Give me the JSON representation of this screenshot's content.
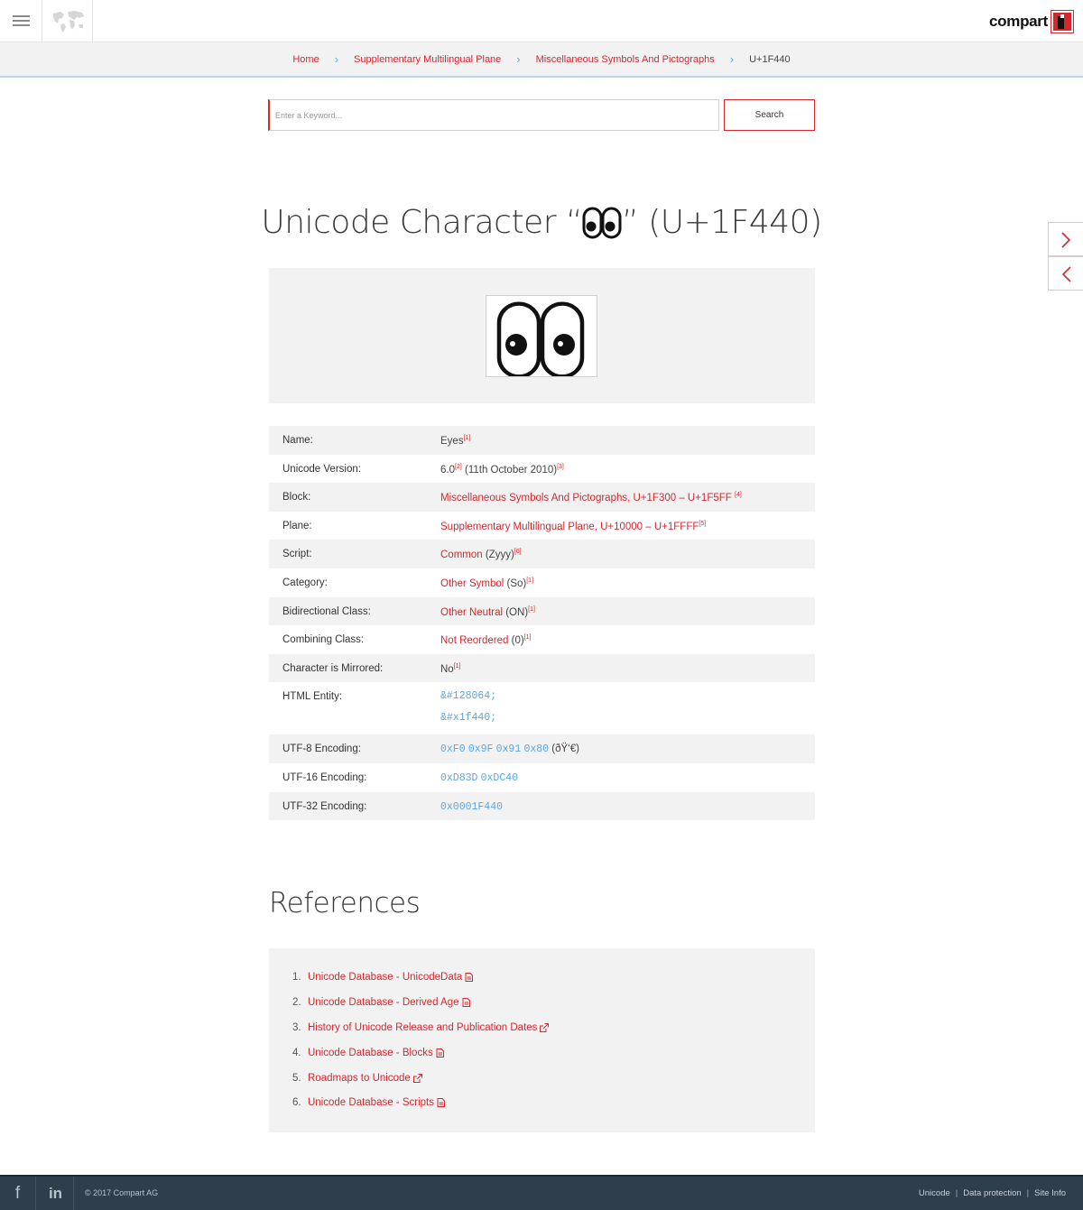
{
  "header": {
    "logo_text": "compart"
  },
  "breadcrumb": {
    "items": [
      "Home",
      "Supplementary Multilingual Plane",
      "Miscellaneous Symbols And Pictographs"
    ],
    "current": "U+1F440"
  },
  "search": {
    "placeholder": "Enter a Keyword...",
    "button_label": "Search"
  },
  "title": {
    "prefix": "Unicode Character “",
    "suffix": "” (U+1F440)"
  },
  "properties": {
    "name_label": "Name:",
    "name_value": "Eyes",
    "name_ref": "[1]",
    "version_label": "Unicode Version:",
    "version_value": "6.0",
    "version_ref": "[2]",
    "version_date": " (11th October 2010)",
    "version_date_ref": "[3]",
    "block_label": "Block:",
    "block_value": "Miscellaneous Symbols And Pictographs",
    "block_range": ", U+1F300 – U+1F5FF",
    "block_ref": "[4]",
    "plane_label": "Plane:",
    "plane_value": "Supplementary Multilingual Plane",
    "plane_range": ", U+10000 – U+1FFFF",
    "plane_ref": "[5]",
    "script_label": "Script:",
    "script_value": "Common",
    "script_code": " (Zyyy)",
    "script_ref": "[6]",
    "category_label": "Category:",
    "category_value": "Other Symbol",
    "category_code": " (So)",
    "category_ref": "[1]",
    "bidi_label": "Bidirectional Class:",
    "bidi_value": "Other Neutral",
    "bidi_code": " (ON)",
    "bidi_ref": "[1]",
    "combining_label": "Combining Class:",
    "combining_value": "Not Reordered",
    "combining_code": " (0)",
    "combining_ref": "[1]",
    "mirrored_label": "Character is Mirrored:",
    "mirrored_value": "No",
    "mirrored_ref": "[1]",
    "entity_label": "HTML Entity:",
    "entity_dec": "&#128064;",
    "entity_hex": "&#x1f440;",
    "utf8_label": "UTF-8 Encoding:",
    "utf8_bytes": [
      "0xF0",
      "0x9F",
      "0x91",
      "0x80"
    ],
    "utf8_chars": " (ðŸ‘€)",
    "utf16_label": "UTF-16 Encoding:",
    "utf16_units": [
      "0xD83D",
      "0xDC40"
    ],
    "utf32_label": "UTF-32 Encoding:",
    "utf32_value": "0x0001F440"
  },
  "references": {
    "title": "References",
    "items": [
      {
        "num": "1.",
        "label": "Unicode Database - UnicodeData",
        "icon": "document-icon"
      },
      {
        "num": "2.",
        "label": "Unicode Database - Derived Age",
        "icon": "document-icon"
      },
      {
        "num": "3.",
        "label": "History of Unicode Release and Publication Dates",
        "icon": "external-link-icon"
      },
      {
        "num": "4.",
        "label": "Unicode Database - Blocks",
        "icon": "document-icon"
      },
      {
        "num": "5.",
        "label": "Roadmaps to Unicode",
        "icon": "external-link-icon"
      },
      {
        "num": "6.",
        "label": "Unicode Database - Scripts",
        "icon": "document-icon"
      }
    ]
  },
  "footer": {
    "facebook": "f",
    "linkedin": "in",
    "copyright": "© 2017 Compart AG",
    "links": [
      "Unicode",
      "Data protection",
      "Site Info"
    ],
    "separator": "|"
  },
  "colors": {
    "accent_red": "#d7262e",
    "link_blue": "#5aa7df",
    "footer_bg": "#2f3e4c"
  }
}
